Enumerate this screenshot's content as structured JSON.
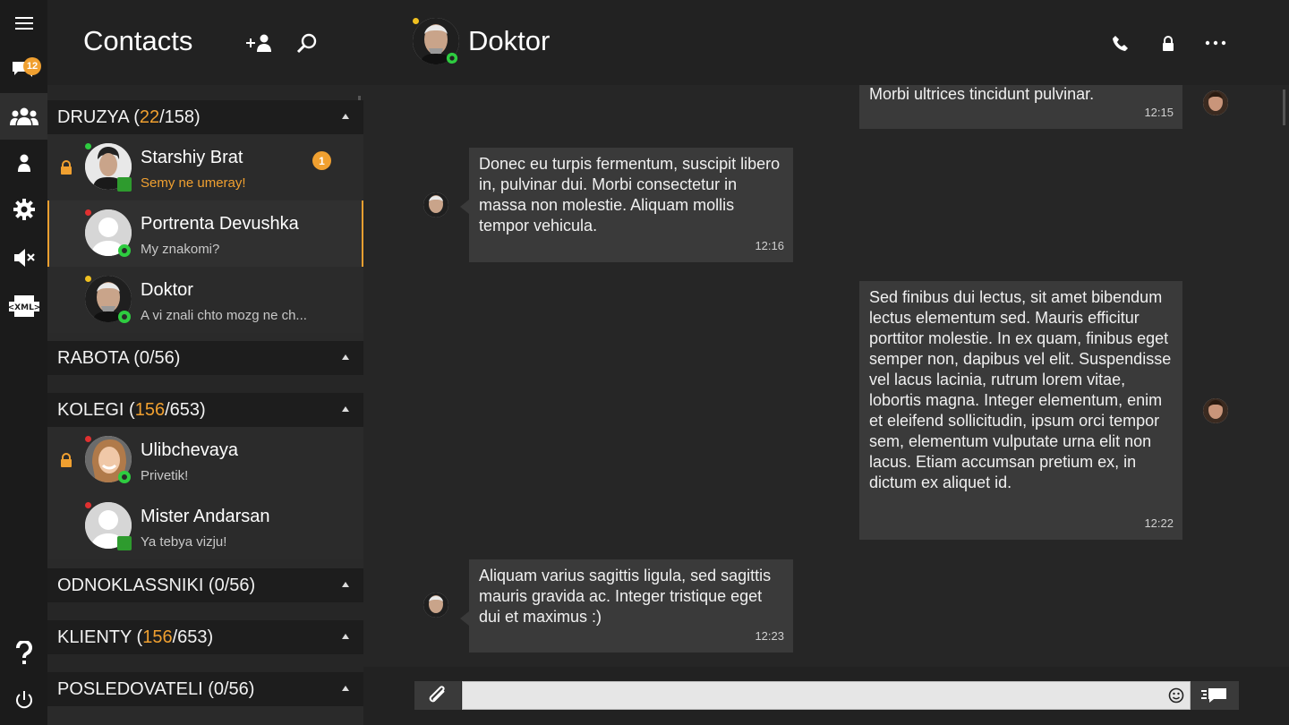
{
  "rail": {
    "items": [
      {
        "icon": "menu-icon"
      },
      {
        "icon": "chat-bubbles-icon",
        "badge": "12"
      },
      {
        "icon": "contacts-group-icon",
        "active": true
      },
      {
        "icon": "person-icon"
      },
      {
        "icon": "gear-icon"
      },
      {
        "icon": "speaker-mute-icon"
      },
      {
        "icon": "xml-icon"
      },
      {
        "icon": "help-icon"
      },
      {
        "icon": "power-icon"
      }
    ]
  },
  "contacts": {
    "title": "Contacts",
    "groups": [
      {
        "name": "DRUZYA (",
        "online": "22",
        "rest": "/158)"
      },
      {
        "name": "RABOTA (0/56)"
      },
      {
        "name": "KOLEGI (",
        "online": "156",
        "rest": "/653)"
      },
      {
        "name": "ODNOKLASSNIKI (0/56)"
      },
      {
        "name": "KLIENTY (",
        "online": "156",
        "rest": "/653)"
      },
      {
        "name": "POSLEDOVATELI (0/56)"
      }
    ],
    "items": [
      {
        "name": "Starshiy Brat",
        "message": "Semy ne umeray!",
        "unread": "1",
        "status_color": "#2ecc40",
        "locked": true
      },
      {
        "name": "Portrenta Devushka",
        "message": "My znakomi?",
        "status_color": "#e03030",
        "locked": false
      },
      {
        "name": "Doktor",
        "message": "A vi znali chto mozg ne ch...",
        "status_color": "#f0c020",
        "locked": false
      },
      {
        "name": "Ulibchevaya",
        "message": "Privetik!",
        "status_color": "#e03030",
        "locked": true
      },
      {
        "name": "Mister Andarsan",
        "message": "Ya tebya vizju!",
        "status_color": "#e03030",
        "locked": false
      }
    ]
  },
  "chat": {
    "contact_name": "Doktor",
    "status_color": "#f0c020",
    "messages": [
      {
        "direction": "out",
        "text": "Morbi ultrices tincidunt pulvinar.",
        "time": "12:15"
      },
      {
        "direction": "in",
        "text": "Donec eu turpis fermentum, suscipit libero in, pulvinar dui. Morbi consectetur in massa non molestie. Aliquam mollis tempor vehicula.",
        "time": "12:16"
      },
      {
        "direction": "out",
        "text": "Sed finibus dui lectus, sit amet bibendum lectus elementum sed. Mauris efficitur porttitor molestie. In ex quam, finibus eget semper non, dapibus vel elit. Suspendisse vel lacus lacinia, rutrum lorem vitae, lobortis magna. Integer elementum, enim et eleifend sollicitudin, ipsum orci tempor sem, elementum vulputate urna elit non lacus. Etiam accumsan pretium ex, in dictum ex aliquet id.",
        "time": "12:22"
      },
      {
        "direction": "in",
        "text": "Aliquam varius sagittis ligula, sed sagittis mauris gravida ac. Integer tristique eget dui et maximus :)",
        "time": "12:23"
      }
    ],
    "composer": {
      "value": "",
      "placeholder": ""
    }
  },
  "colors": {
    "accent": "#f0a030",
    "online": "#2ecc40",
    "busy": "#e03030",
    "away": "#f0c020"
  }
}
